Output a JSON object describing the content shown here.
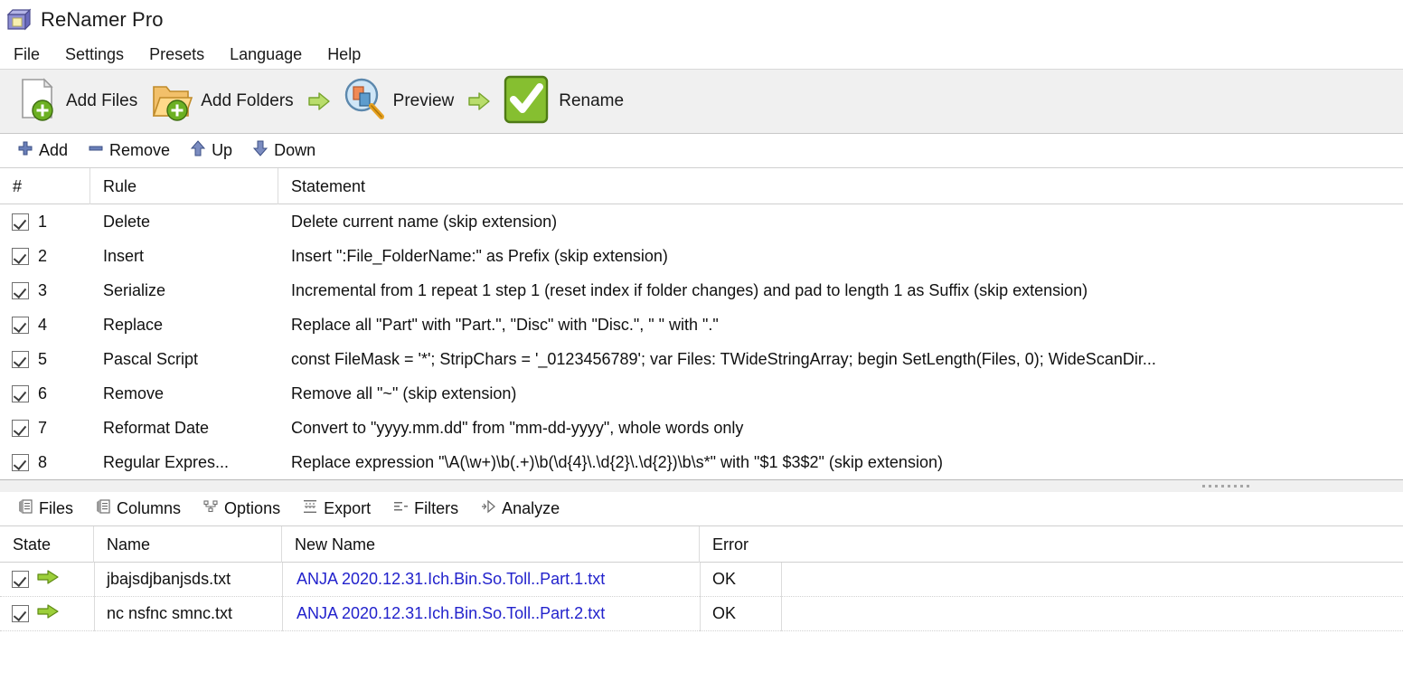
{
  "window": {
    "title": "ReNamer Pro",
    "icon": "app-folder-note-icon"
  },
  "menubar": {
    "items": [
      {
        "label": "File"
      },
      {
        "label": "Settings"
      },
      {
        "label": "Presets"
      },
      {
        "label": "Language"
      },
      {
        "label": "Help"
      }
    ]
  },
  "toolbar": {
    "buttons": [
      {
        "label": "Add Files",
        "icon": "add-files-icon"
      },
      {
        "label": "Add Folders",
        "icon": "add-folders-icon"
      },
      {
        "label": "Preview",
        "icon": "preview-magnifier-icon"
      },
      {
        "label": "Rename",
        "icon": "rename-checkmark-icon"
      }
    ],
    "arrow_icon": "green-arrow-right-icon"
  },
  "rules_toolbar": {
    "buttons": [
      {
        "label": "Add",
        "icon": "plus-icon"
      },
      {
        "label": "Remove",
        "icon": "minus-icon"
      },
      {
        "label": "Up",
        "icon": "arrow-up-icon"
      },
      {
        "label": "Down",
        "icon": "arrow-down-icon"
      }
    ]
  },
  "rules_grid": {
    "columns": [
      "#",
      "Rule",
      "Statement"
    ],
    "rows": [
      {
        "checked": true,
        "num": "1",
        "rule": "Delete",
        "statement": "Delete current name (skip extension)"
      },
      {
        "checked": true,
        "num": "2",
        "rule": "Insert",
        "statement": "Insert \":File_FolderName:\" as Prefix (skip extension)"
      },
      {
        "checked": true,
        "num": "3",
        "rule": "Serialize",
        "statement": "Incremental from 1 repeat 1 step 1 (reset index if folder changes) and pad to length 1 as Suffix (skip extension)"
      },
      {
        "checked": true,
        "num": "4",
        "rule": "Replace",
        "statement": "Replace all \"Part\" with \"Part.\", \"Disc\" with \"Disc.\", \" \" with \".\""
      },
      {
        "checked": true,
        "num": "5",
        "rule": "Pascal Script",
        "statement": "const FileMask = '*'; StripChars = '_0123456789'; var Files: TWideStringArray; begin SetLength(Files, 0); WideScanDir..."
      },
      {
        "checked": true,
        "num": "6",
        "rule": "Remove",
        "statement": "Remove all \"~\" (skip extension)"
      },
      {
        "checked": true,
        "num": "7",
        "rule": "Reformat Date",
        "statement": "Convert to \"yyyy.mm.dd\" from \"mm-dd-yyyy\", whole words only"
      },
      {
        "checked": true,
        "num": "8",
        "rule": "Regular Expres...",
        "statement": "Replace expression \"\\A(\\w+)\\b(.+)\\b(\\d{4}\\.\\d{2}\\.\\d{2})\\b\\s*\" with \"$1 $3$2\" (skip extension)"
      }
    ]
  },
  "bottom_tabs": {
    "items": [
      {
        "label": "Files",
        "icon": "files-list-icon",
        "active": true
      },
      {
        "label": "Columns",
        "icon": "columns-list-icon",
        "active": false
      },
      {
        "label": "Options",
        "icon": "options-nodes-icon",
        "active": false
      },
      {
        "label": "Export",
        "icon": "export-icon",
        "active": false
      },
      {
        "label": "Filters",
        "icon": "filters-icon",
        "active": false
      },
      {
        "label": "Analyze",
        "icon": "analyze-icon",
        "active": false
      }
    ]
  },
  "files_grid": {
    "columns": [
      "State",
      "Name",
      "New Name",
      "Error"
    ],
    "rows": [
      {
        "checked": true,
        "state_icon": "green-arrow-right-icon",
        "name": "jbajsdjbanjsds.txt",
        "new_name": "ANJA 2020.12.31.Ich.Bin.So.Toll..Part.1.txt",
        "error": "OK"
      },
      {
        "checked": true,
        "state_icon": "green-arrow-right-icon",
        "name": "nc nsfnc smnc.txt",
        "new_name": "ANJA 2020.12.31.Ich.Bin.So.Toll..Part.2.txt",
        "error": "OK"
      }
    ]
  },
  "colors": {
    "new_name_text": "#2222cc",
    "toolbar_bg": "#f0f0f0",
    "accent_green": "#7cb518",
    "text": "#111111"
  }
}
